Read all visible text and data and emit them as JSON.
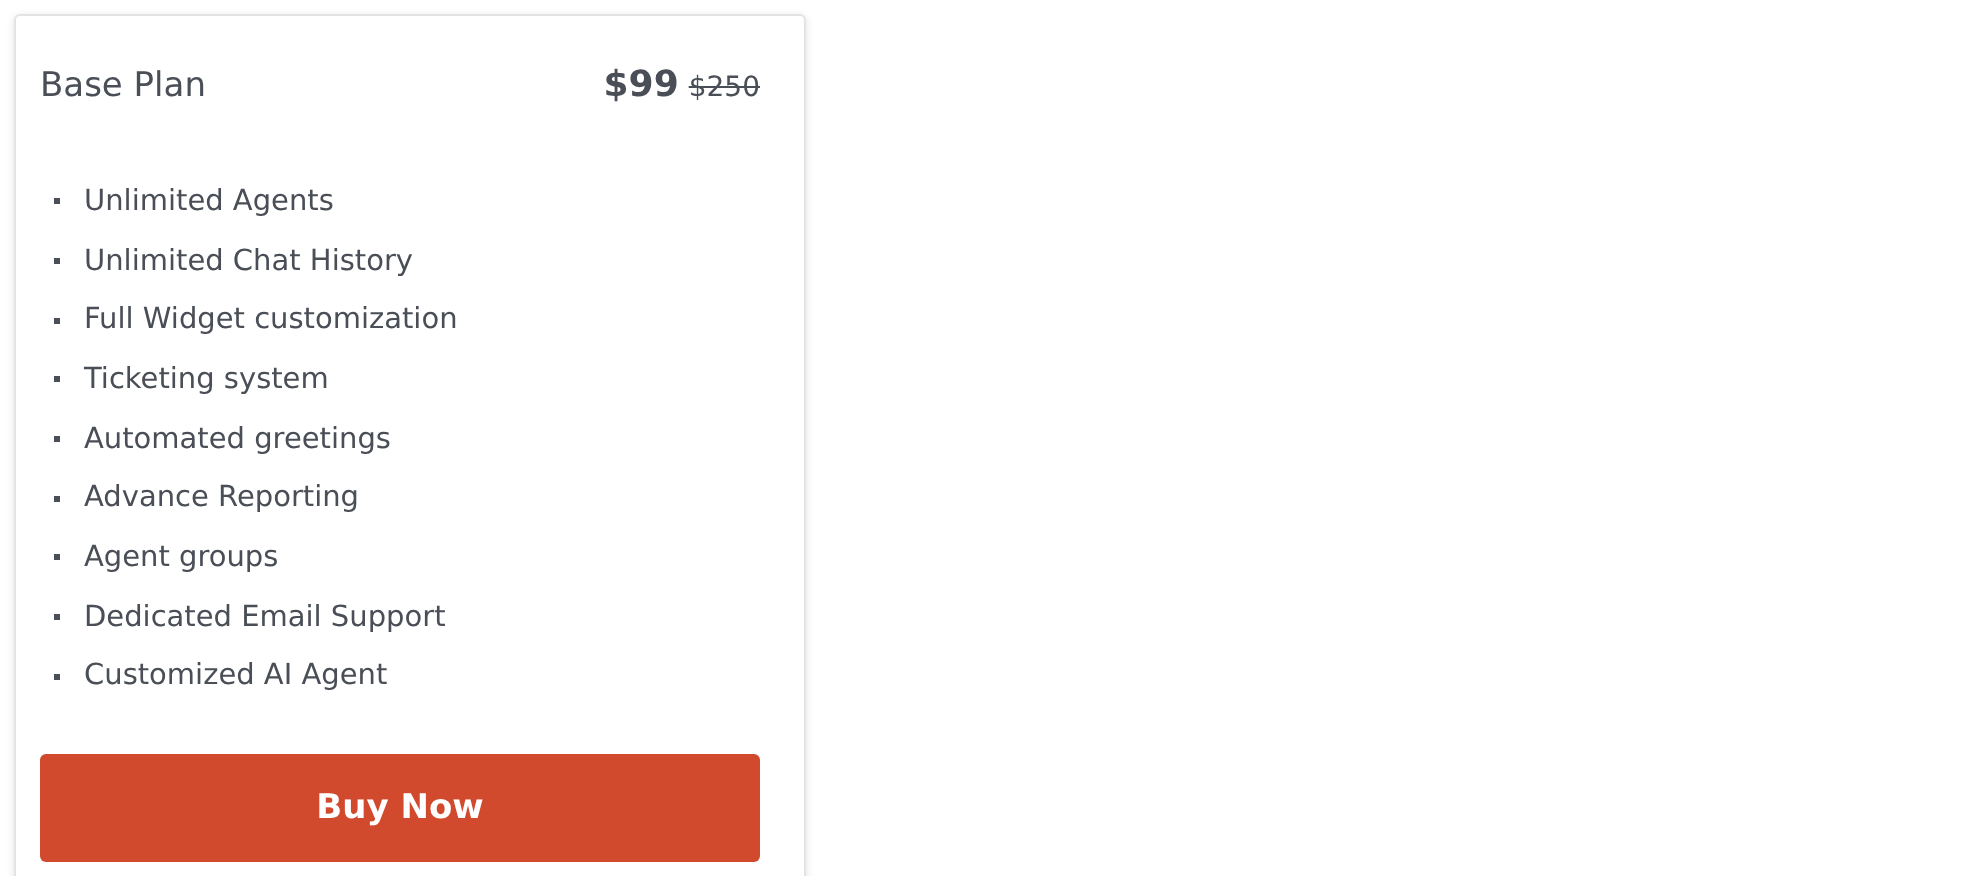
{
  "plan": {
    "title": "Base Plan",
    "price": "$99",
    "old_price": "$250"
  },
  "features": [
    "Unlimited Agents",
    "Unlimited Chat History",
    "Full Widget customization",
    "Ticketing system",
    "Automated greetings",
    "Advance Reporting",
    "Agent groups",
    "Dedicated Email Support",
    "Customized AI Agent"
  ],
  "button": {
    "label": "Buy Now"
  }
}
